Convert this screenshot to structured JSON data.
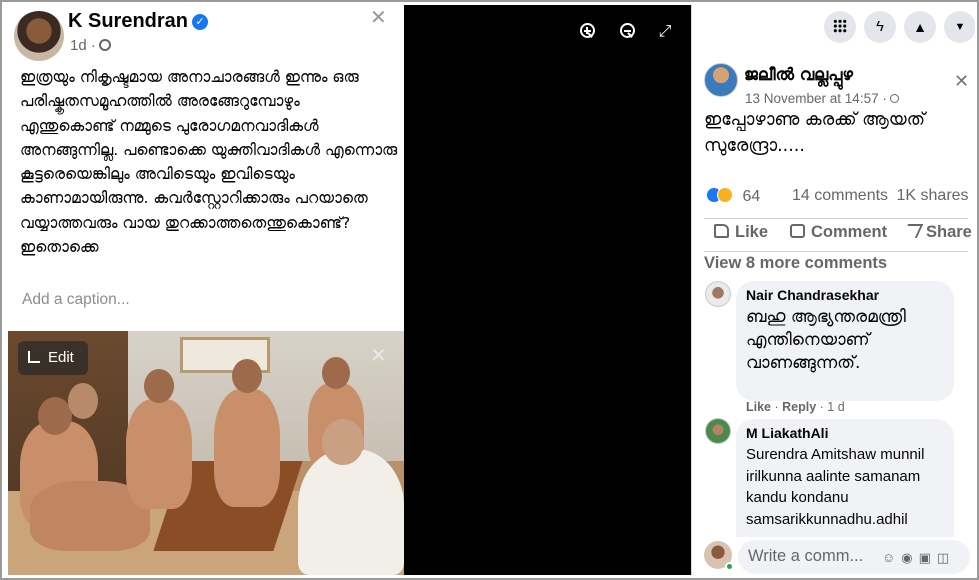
{
  "post": {
    "author": "K Surendran",
    "time": "1d ·",
    "text": "ഇത്രയും നികൃഷ്ടമായ അനാചാരങ്ങൾ ഇന്നും ഒരു പരിഷ്കൃതസമൂഹത്തിൽ അരങ്ങേറുമ്പോഴും എന്തുകൊണ്ട് നമ്മുടെ പുരോഗമനവാദികൾ അനങ്ങുന്നില്ല. പണ്ടൊക്കെ യുക്തിവാദികൾ എന്നൊരു കൂട്ടരെയെങ്കിലും അവിടെയും ഇവിടെയും കാണാമായിരുന്നു. കവർസ്റ്റോറിക്കാരും പറയാതെ വയ്യാത്തവരും വായ തുറക്കാത്തതെന്തുകൊണ്ട്? ഇതൊക്കെ",
    "caption_placeholder": "Add a caption...",
    "edit_label": "Edit",
    "icons": {
      "verified": "verified-check-icon",
      "privacy": "globe-icon",
      "close": "close-icon",
      "crop": "crop-icon"
    }
  },
  "viewer": {
    "icons": [
      "zoom-in-icon",
      "zoom-out-icon",
      "fullscreen-icon"
    ]
  },
  "topbar": {
    "icons": [
      "menu-grid-icon",
      "messenger-icon",
      "notifications-icon",
      "account-dropdown-icon"
    ]
  },
  "shared": {
    "name": "ജലീൽ വല്ലപ്പുഴ",
    "time": "13 November at 14:57 ·",
    "text": "ഇപ്പോഴാണു കരക്ക് ആയത് സുരേന്ദ്രാ.....",
    "reaction_count": "64",
    "comments_count": "14 comments",
    "shares_count": "1K shares",
    "actions": {
      "like": "Like",
      "comment": "Comment",
      "share": "Share"
    },
    "view_more": "View 8 more comments"
  },
  "comments": [
    {
      "name": "Nair Chandrasekhar",
      "text": "ബഹു ആഭ്യന്തരമന്ത്രി എന്തിനെയാണ് വാണങ്ങുന്നത്.",
      "like": "Like",
      "reply": "Reply",
      "time": "1 d"
    },
    {
      "name": "M LiakathAli",
      "text": "Surendra Amitshaw munnil irilkunna aalinte samanam kandu kondanu samsarikkunnadhu.adhil"
    }
  ],
  "composer": {
    "placeholder": "Write a comm...",
    "icons": [
      "emoji-icon",
      "camera-icon",
      "gif-icon",
      "sticker-icon"
    ]
  },
  "colors": {
    "accent": "#1877f2",
    "secondary_text": "#65676b",
    "bubble": "#f0f2f5",
    "viewer_bg": "#000000"
  }
}
